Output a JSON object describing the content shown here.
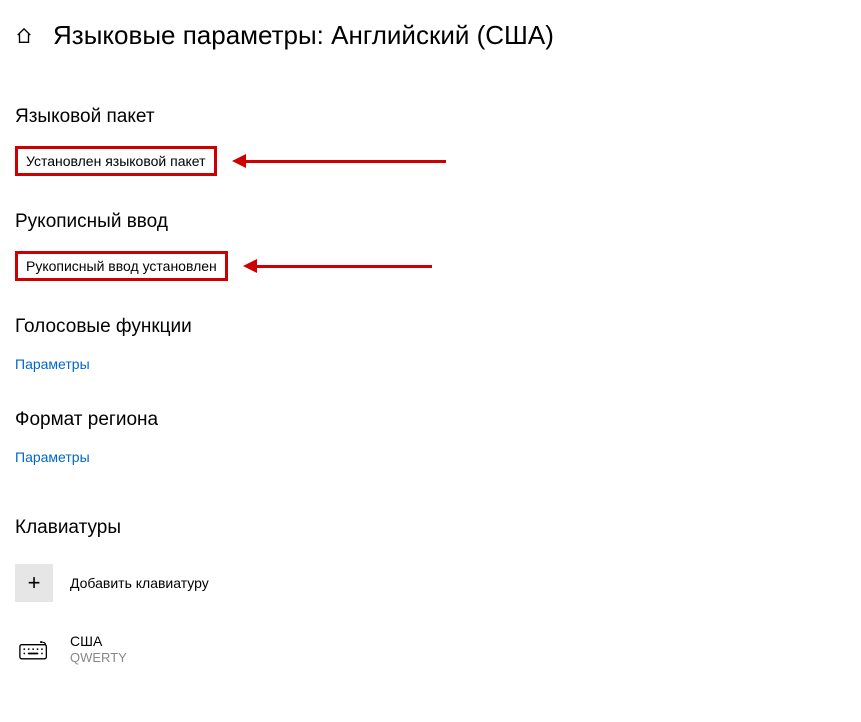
{
  "header": {
    "title": "Языковые параметры: Английский (США)"
  },
  "sections": {
    "languagePack": {
      "heading": "Языковой пакет",
      "status": "Установлен языковой пакет"
    },
    "handwriting": {
      "heading": "Рукописный ввод",
      "status": "Рукописный ввод установлен"
    },
    "speech": {
      "heading": "Голосовые функции",
      "link": "Параметры"
    },
    "regionFormat": {
      "heading": "Формат региона",
      "link": "Параметры"
    },
    "keyboards": {
      "heading": "Клавиатуры",
      "addLabel": "Добавить клавиатуру",
      "items": [
        {
          "name": "США",
          "layout": "QWERTY"
        }
      ]
    }
  }
}
